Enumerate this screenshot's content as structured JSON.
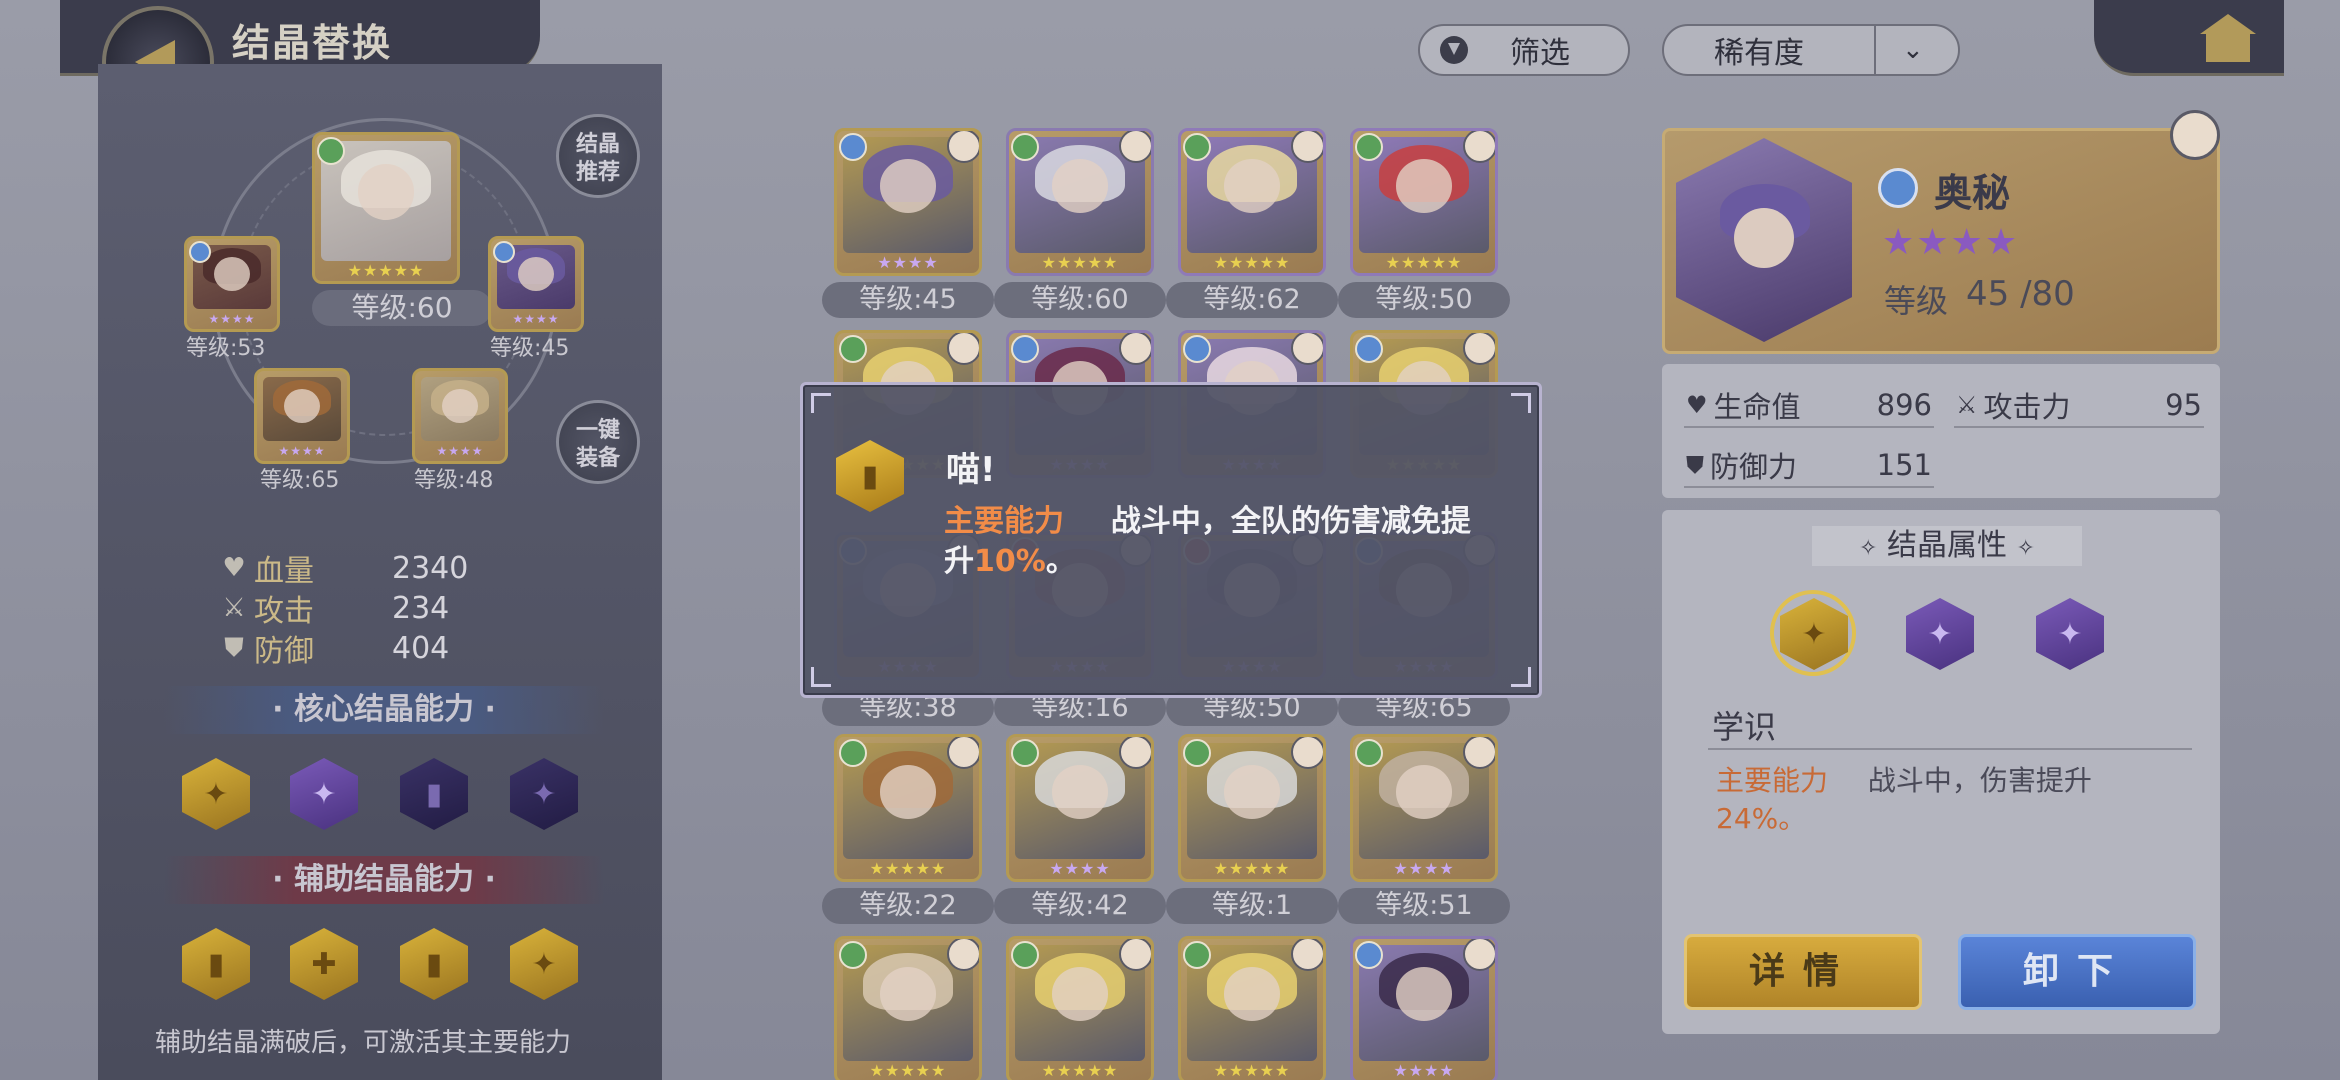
{
  "header": {
    "title": "结晶替换",
    "filter_label": "筛选",
    "sort_label": "稀有度",
    "sort_chevron": "⌄"
  },
  "left": {
    "main_level": "等级:60",
    "slots": [
      {
        "level": "等级:53"
      },
      {
        "level": "等级:45"
      },
      {
        "level": "等级:65"
      },
      {
        "level": "等级:48"
      }
    ],
    "recommend_btn": [
      "结晶",
      "推荐"
    ],
    "equip_btn": [
      "一键",
      "装备"
    ],
    "stats": [
      {
        "label": "血量",
        "value": "2340",
        "icon": "heart-icon"
      },
      {
        "label": "攻击",
        "value": "234",
        "icon": "swords-icon"
      },
      {
        "label": "防御",
        "value": "404",
        "icon": "shield-icon"
      }
    ],
    "core_title": "· 核心结晶能力 ·",
    "aux_title": "· 辅助结晶能力 ·",
    "footnote": "辅助结晶满破后，可激活其主要能力"
  },
  "grid": {
    "levels": [
      [
        "等级:45",
        "等级:60",
        "等级:62",
        "等级:50"
      ],
      [
        "",
        "",
        "",
        ""
      ],
      [
        "等级:38",
        "等级:16",
        "等级:50",
        "等级:65"
      ],
      [
        "等级:22",
        "等级:42",
        "等级:1",
        "等级:51"
      ]
    ]
  },
  "selected": {
    "name": "奥秘",
    "stars": "★★★★",
    "level_label": "等级",
    "level": "45 /80",
    "stats": {
      "hp_label": "生命值",
      "hp": "896",
      "atk_label": "攻击力",
      "atk": "95",
      "def_label": "防御力",
      "def": "151"
    },
    "attr_title": "结晶属性",
    "skill_name": "学识",
    "skill_prefix": "主要能力",
    "skill_desc": "战斗中，伤害提升",
    "skill_value": "24%。",
    "detail_btn": "详情",
    "unequip_btn": "卸下"
  },
  "popup": {
    "title": "喵!",
    "prefix": "主要能力",
    "line1": "战斗中，全队的伤害减免提",
    "line2a": "升",
    "value": "10%",
    "line2b": "。"
  },
  "colors": {
    "gold": "#d8b23a",
    "purple": "#7a5ab8",
    "orange": "#c86a36",
    "accent_blue": "#5a84d8"
  }
}
